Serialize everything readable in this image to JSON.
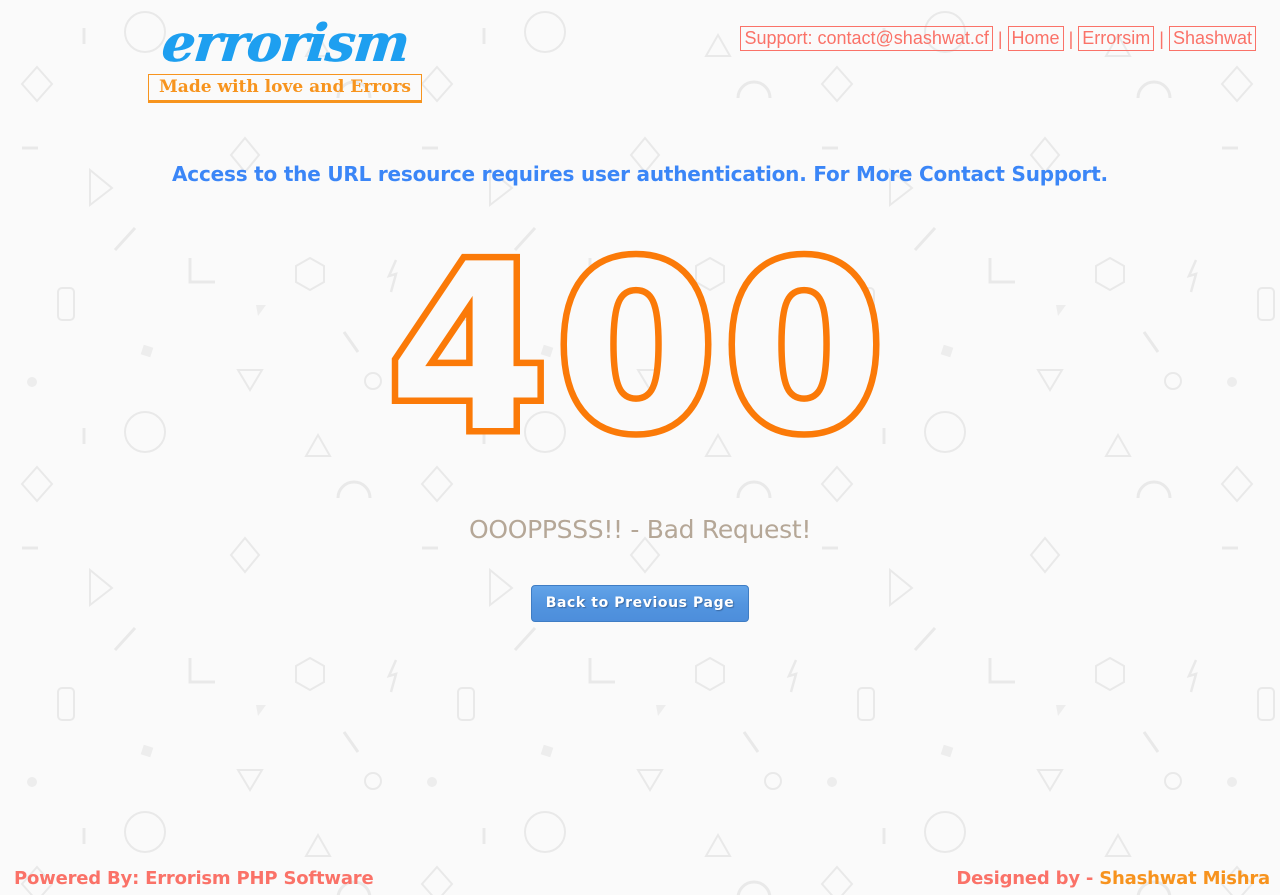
{
  "brand": {
    "word": "errorism",
    "tagline": "Made with love and Errors",
    "word_color": "#1e9ff0",
    "tagline_color": "#f7941e"
  },
  "topnav": {
    "color": "#fa7268",
    "separator": "|",
    "items": [
      {
        "label": "Support: contact@shashwat.cf",
        "name": "support-email"
      },
      {
        "label": "Home",
        "name": "home"
      },
      {
        "label": "Errorsim",
        "name": "errorsim"
      },
      {
        "label": "Shashwat",
        "name": "shashwat"
      }
    ]
  },
  "main": {
    "message": "Access to the URL resource requires user authentication. For More Contact Support.",
    "message_color": "#3b86f7",
    "error_code": "400",
    "error_code_color": "#fb7a08",
    "subtitle": "OOOPPSSS!! - Bad Request!",
    "subtitle_color": "#b5a797",
    "back_button_label": "Back to Previous Page",
    "back_button_color": "#5294df"
  },
  "footer": {
    "powered_by": "Powered By: Errorism PHP Software",
    "designed_by_prefix": "Designed by - ",
    "designed_by_author": "Shashwat Mishra",
    "prefix_color": "#fa7268",
    "author_color": "#f7931e"
  },
  "background": {
    "page_color": "#fafafa",
    "shape_color": "#e9e9e9",
    "tile_size": 400,
    "shapes": [
      "diamond-outline",
      "triangle-outline",
      "circle-outline",
      "hexagon-outline",
      "rounded-rect-outline",
      "slash-line",
      "corner-bracket",
      "dot-filled",
      "small-square",
      "bolt",
      "arc",
      "dash"
    ]
  }
}
